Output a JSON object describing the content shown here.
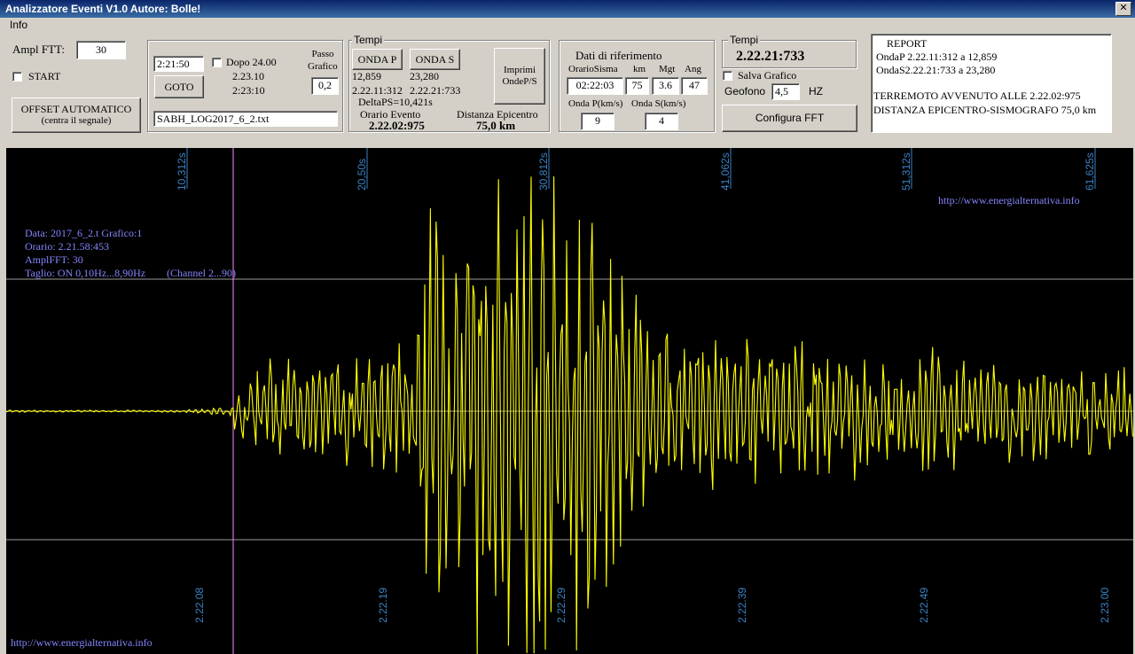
{
  "window": {
    "title": "Analizzatore Eventi V1.0  Autore: Bolle!"
  },
  "menu": {
    "info": "Info"
  },
  "left": {
    "ampl_label": "Ampl FTT:",
    "ampl_value": "30",
    "start_label": "START",
    "offset_line1": "OFFSET AUTOMATICO",
    "offset_line2": "(centra il segnale)"
  },
  "goto_group": {
    "time_value": "2:21:50",
    "dopo_label": "Dopo 24.00",
    "time1": "2.23.10",
    "time2": "2:23:10",
    "goto_label": "GOTO",
    "passo_label1": "Passo",
    "passo_label2": "Grafico",
    "passo_value": "0,2",
    "file_value": "SABH_LOG2017_6_2.txt"
  },
  "tempi1": {
    "title": "Tempi",
    "onda_p_label": "ONDA P",
    "onda_s_label": "ONDA S",
    "p_sec": "12,859",
    "s_sec": "23,280",
    "p_time": "2.22.11:312",
    "s_time": "2.22.21:733",
    "delta": "DeltaPS=10,421s",
    "orario_label": "Orario Evento",
    "orario_value": "2.22.02:975",
    "distanza_label": "Distanza Epicentro",
    "distanza_value": "75,0 km",
    "imprimi_line1": "Imprimi",
    "imprimi_line2": "OndeP/S"
  },
  "riferimento": {
    "title": "Dati di riferimento",
    "col_orario": "OrarioSisma",
    "col_km": "km",
    "col_mgt": "Mgt",
    "col_ang": "Ang",
    "orario_value": "02:22:03",
    "km_value": "75",
    "mgt_value": "3.6",
    "ang_value": "47",
    "onda_p_label": "Onda P(km/s)",
    "onda_s_label": "Onda S(km/s)",
    "onda_p_value": "9",
    "onda_s_value": "4"
  },
  "tempi2": {
    "title": "Tempi",
    "value": "2.22.21:733",
    "salva_label": "Salva Grafico",
    "geofono_label": "Geofono",
    "geofono_value": "4,5",
    "hz_label": "HZ",
    "configura_label": "Configura FFT"
  },
  "report": {
    "title": "REPORT",
    "line1": "OndaP 2.22.11:312 a 12,859",
    "line2": "OndaS2.22.21:733 a 23,280",
    "line3": "TERREMOTO AVVENUTO ALLE 2.22.02:975",
    "line4": "DISTANZA EPICENTRO-SISMOGRAFO 75,0 km"
  },
  "plot": {
    "url_top": "http://www.energialternativa.info",
    "url_bottom": "http://www.energialternativa.info",
    "info_data": "Data: 2017_6_2.t Grafico:1",
    "info_orario": "Orario: 2.21.58:453",
    "info_ampl": "AmplFFT: 30",
    "info_taglio": "Taglio: ON 0,10Hz...8,90Hz",
    "info_channel": "(Channel 2...90)",
    "top_ticks": [
      "10,312s",
      "20,50s",
      "30,812s",
      "41,062s",
      "51,312s",
      "61,625s"
    ],
    "bottom_ticks": [
      "2.22.08",
      "2.22.19",
      "2.22.29",
      "2.22.39",
      "2.22.49",
      "2.23.00"
    ],
    "colors": {
      "background": "#000000",
      "signal": "#ffff00",
      "grid": "#9a9a9a",
      "marker": "#ff88ff",
      "label": "#3b82c4",
      "text": "#8585ff"
    }
  }
}
